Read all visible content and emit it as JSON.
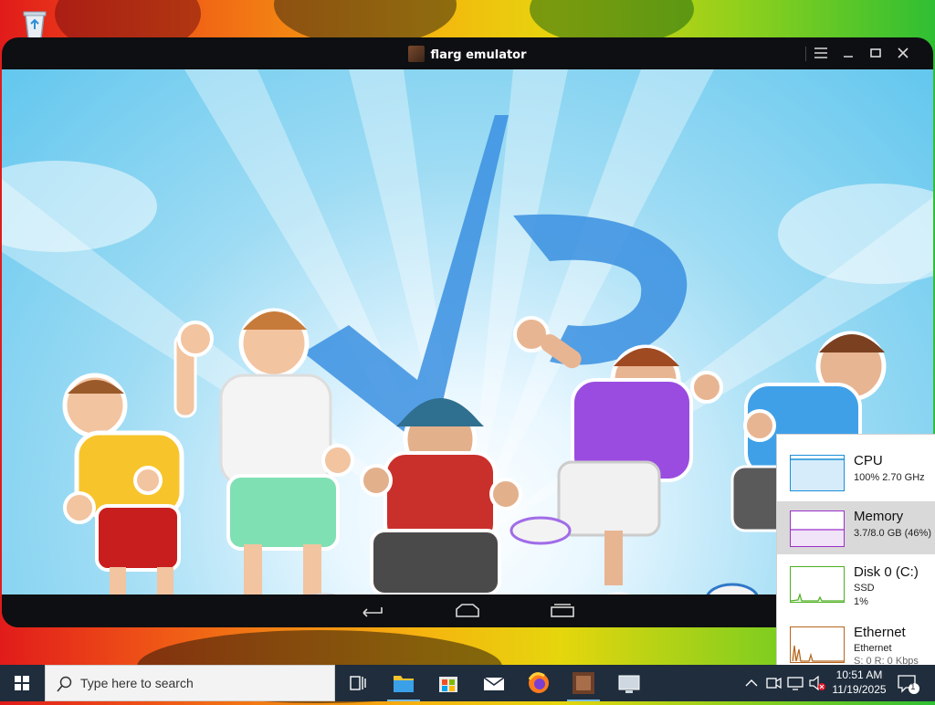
{
  "emulator": {
    "title": "flarg emulator"
  },
  "task_manager": {
    "cpu": {
      "name": "CPU",
      "detail": "100%  2.70 GHz"
    },
    "memory": {
      "name": "Memory",
      "detail": "3.7/8.0 GB (46%)"
    },
    "disk": {
      "name": "Disk 0 (C:)",
      "type": "SSD",
      "usage": "1%"
    },
    "ethernet": {
      "name": "Ethernet",
      "type": "Ethernet",
      "throughput": "S: 0 R: 0 Kbps"
    }
  },
  "taskbar": {
    "search_placeholder": "Type here to search",
    "time": "10:51 AM",
    "date": "11/19/2025",
    "notification_count": "1"
  },
  "colors": {
    "accent": "#76b9ed",
    "cpu_graph": "#1a8fd8",
    "memory_graph": "#9b30c8",
    "disk_graph": "#4caf20",
    "ethernet_graph": "#b5651d"
  }
}
